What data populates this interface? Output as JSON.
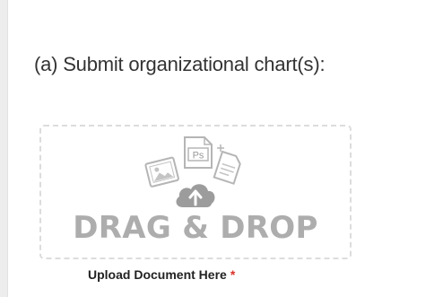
{
  "question": {
    "label": "(a) Submit organizational chart(s):"
  },
  "upload": {
    "dropzone_text": "DRAG & DROP",
    "label": "Upload Document Here",
    "required_marker": "*",
    "icons": [
      "image-file-icon",
      "photoshop-file-icon",
      "text-file-icon",
      "cloud-upload-icon"
    ],
    "ps_badge_text": "Ps"
  },
  "colors": {
    "dropzone_border": "#dcdcdc",
    "icon_gray": "#b5b5b5",
    "drop_text": "#adadad",
    "required": "#d9322b"
  }
}
